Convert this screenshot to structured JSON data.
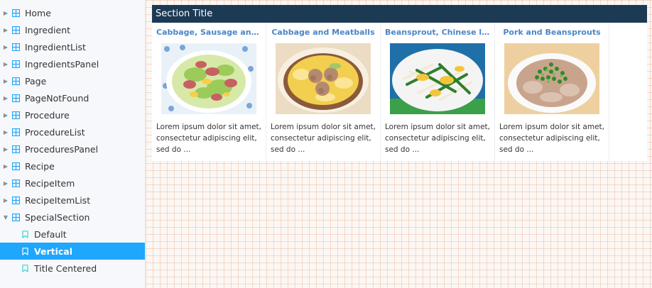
{
  "sidebar": {
    "items": [
      {
        "label": "Home",
        "expanded": false
      },
      {
        "label": "Ingredient",
        "expanded": false
      },
      {
        "label": "IngredientList",
        "expanded": false
      },
      {
        "label": "IngredientsPanel",
        "expanded": false
      },
      {
        "label": "Page",
        "expanded": false
      },
      {
        "label": "PageNotFound",
        "expanded": false
      },
      {
        "label": "Procedure",
        "expanded": false
      },
      {
        "label": "ProcedureList",
        "expanded": false
      },
      {
        "label": "ProceduresPanel",
        "expanded": false
      },
      {
        "label": "Recipe",
        "expanded": false
      },
      {
        "label": "RecipeItem",
        "expanded": false
      },
      {
        "label": "RecipeItemList",
        "expanded": false
      },
      {
        "label": "SpecialSection",
        "expanded": true
      }
    ],
    "stories": [
      {
        "label": "Default",
        "selected": false
      },
      {
        "label": "Vertical",
        "selected": true
      },
      {
        "label": "Title Centered",
        "selected": false
      }
    ],
    "accent_color": "#1ea7fd",
    "component_icon_color": "#1ea7fd",
    "story_icon_color": "#37d5d3"
  },
  "preview": {
    "section_title": "Section Title",
    "header_color": "#1d3a55",
    "link_color": "#4a86c8",
    "cards": [
      {
        "title": "Cabbage, Sausage and Eg...",
        "image": "cabbage-sausage-photo",
        "description": "Lorem ipsum dolor sit amet, consectetur adipiscing elit, sed do ..."
      },
      {
        "title": "Cabbage and Meatballs",
        "image": "cabbage-meatballs-photo",
        "description": "Lorem ipsum dolor sit amet, consectetur adipiscing elit, sed do ..."
      },
      {
        "title": "Beansprout, Chinese leek ...",
        "image": "beansprout-leek-photo",
        "description": "Lorem ipsum dolor sit amet, consectetur adipiscing elit, sed do ..."
      },
      {
        "title": "Pork and Beansprouts",
        "image": "pork-beansprouts-photo",
        "description": "Lorem ipsum dolor sit amet, consectetur adipiscing elit, sed do ..."
      }
    ]
  }
}
